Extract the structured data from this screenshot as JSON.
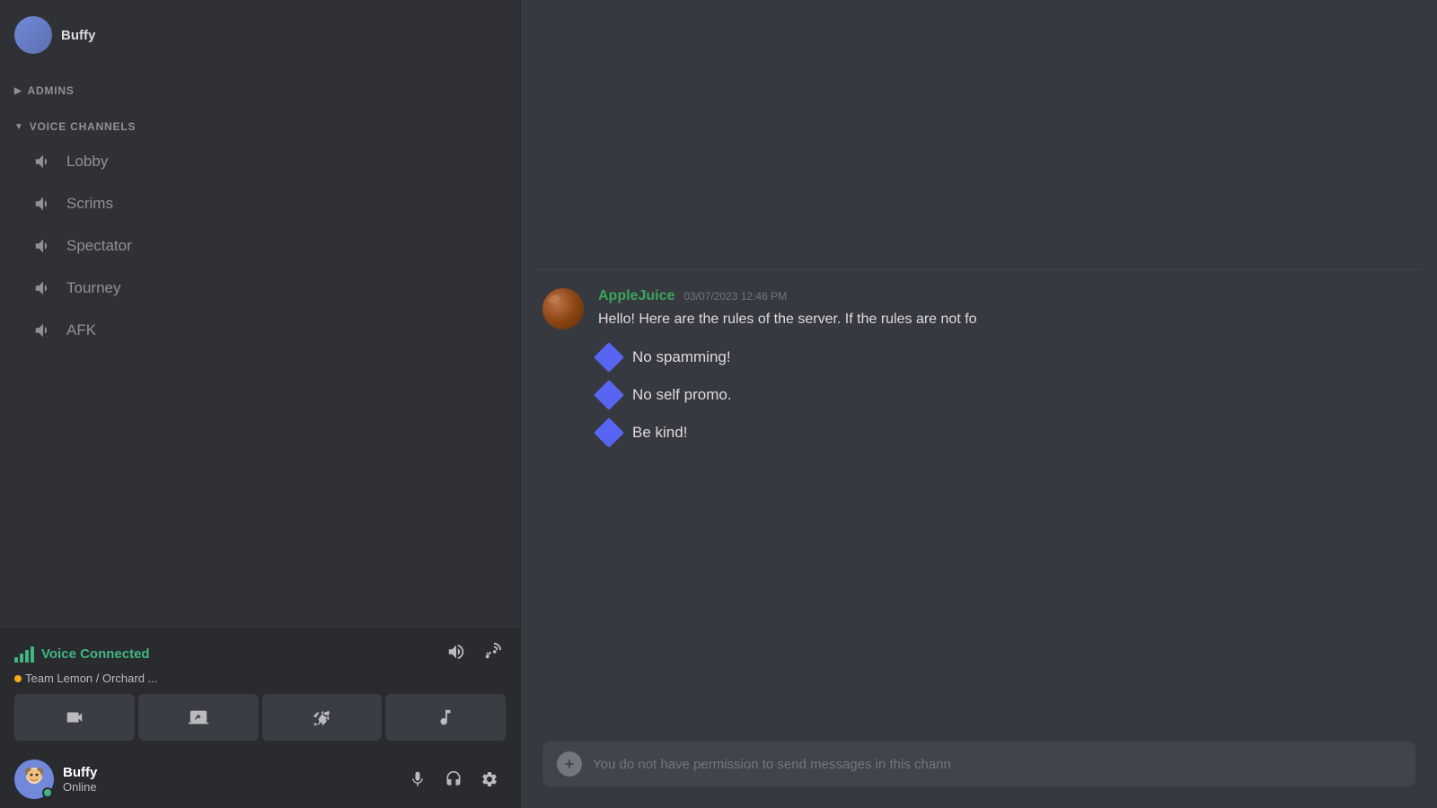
{
  "sidebar": {
    "admins_section_label": "ADMINS",
    "voice_channels_section_label": "VOICE CHANNELS",
    "voice_channels": [
      {
        "id": "lobby",
        "name": "Lobby"
      },
      {
        "id": "scrims",
        "name": "Scrims"
      },
      {
        "id": "spectator",
        "name": "Spectator"
      },
      {
        "id": "tourney",
        "name": "Tourney"
      },
      {
        "id": "afk",
        "name": "AFK"
      }
    ],
    "voice_connected": {
      "label": "Voice Connected",
      "channel_info": "Team Lemon / Orchard ..."
    },
    "user": {
      "name": "Buffy",
      "status": "Online"
    }
  },
  "chat": {
    "message": {
      "author": "AppleJuice",
      "timestamp": "03/07/2023 12:46 PM",
      "text": "Hello! Here are the rules of the server. If the rules are not fo",
      "rules": [
        "No spamming!",
        "No self promo.",
        "Be kind!"
      ]
    },
    "input_placeholder": "You do not have permission to send messages in this chann"
  }
}
